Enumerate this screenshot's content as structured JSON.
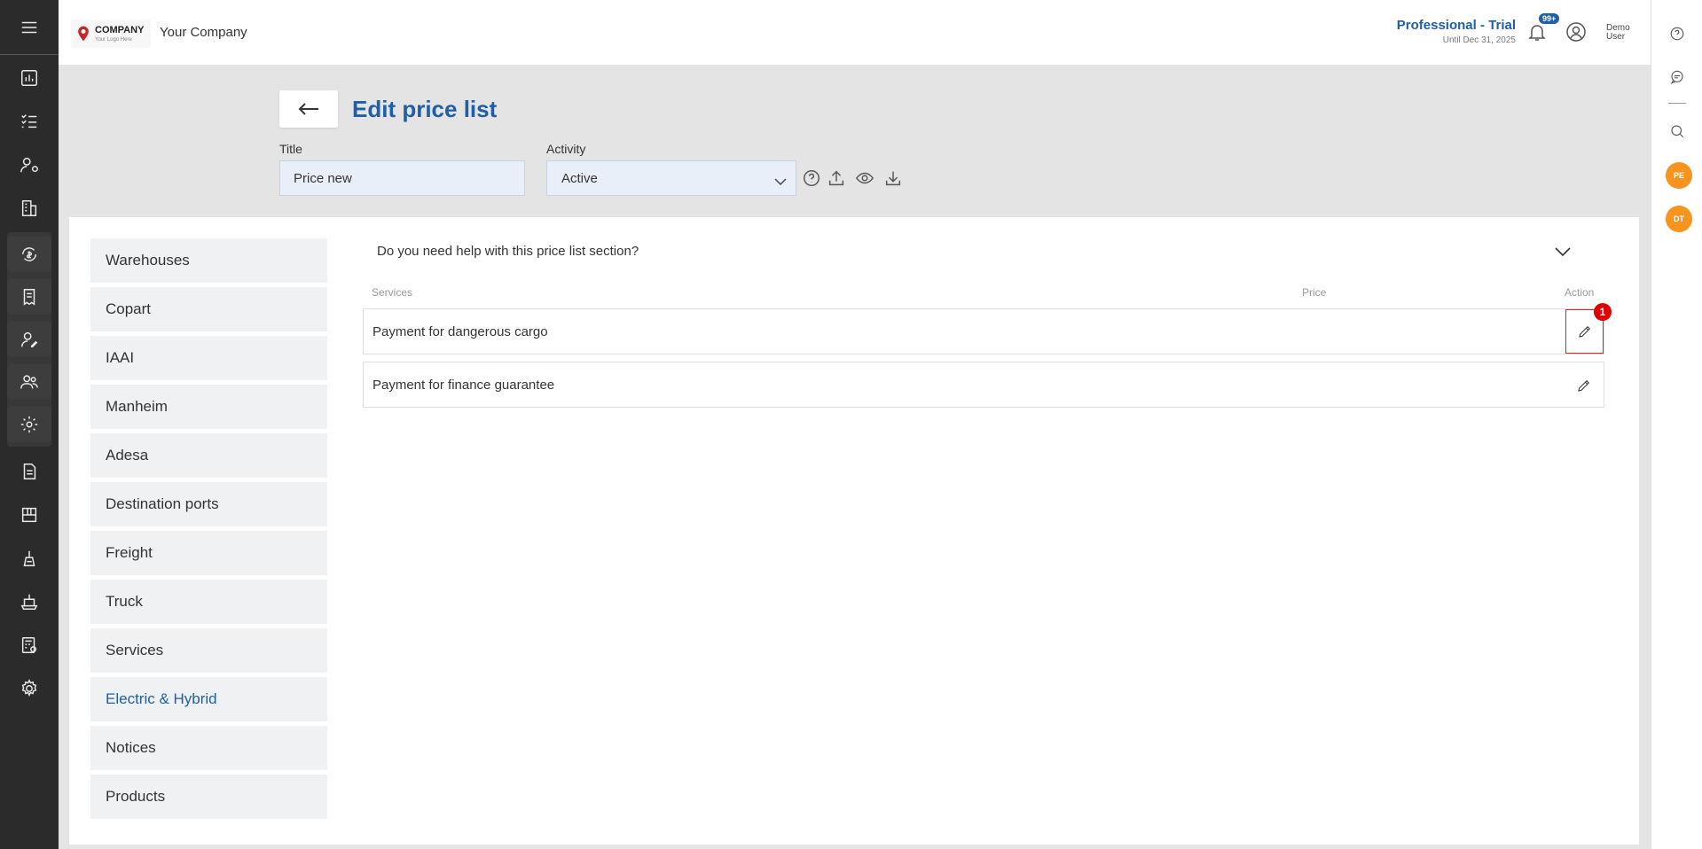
{
  "header": {
    "logo_text": "COMPANY",
    "logo_sub": "Your Logo Here",
    "company_name": "Your Company",
    "plan_name": "Professional - Trial",
    "plan_until": "Until Dec 31, 2025",
    "notif_badge": "99+",
    "user_name": "Demo User"
  },
  "page": {
    "title": "Edit price list",
    "title_label": "Title",
    "title_value": "Price new",
    "activity_label": "Activity",
    "activity_value": "Active"
  },
  "categories": [
    "Warehouses",
    "Copart",
    "IAAI",
    "Manheim",
    "Adesa",
    "Destination ports",
    "Freight",
    "Truck",
    "Services",
    "Electric & Hybrid",
    "Notices",
    "Products"
  ],
  "active_category": "Electric & Hybrid",
  "help": {
    "question": "Do you need help with this price list section?"
  },
  "table": {
    "columns": {
      "services": "Services",
      "price": "Price",
      "action": "Action"
    },
    "rows": [
      {
        "service": "Payment for dangerous cargo",
        "price": ""
      },
      {
        "service": "Payment for finance guarantee",
        "price": ""
      }
    ]
  },
  "marker_label": "1",
  "avatars": [
    "PE",
    "DT"
  ],
  "colors": {
    "accent": "#1e5fa8",
    "sidebar": "#2b2b2b",
    "avatar": "#f7941d",
    "marker": "#e00000"
  }
}
